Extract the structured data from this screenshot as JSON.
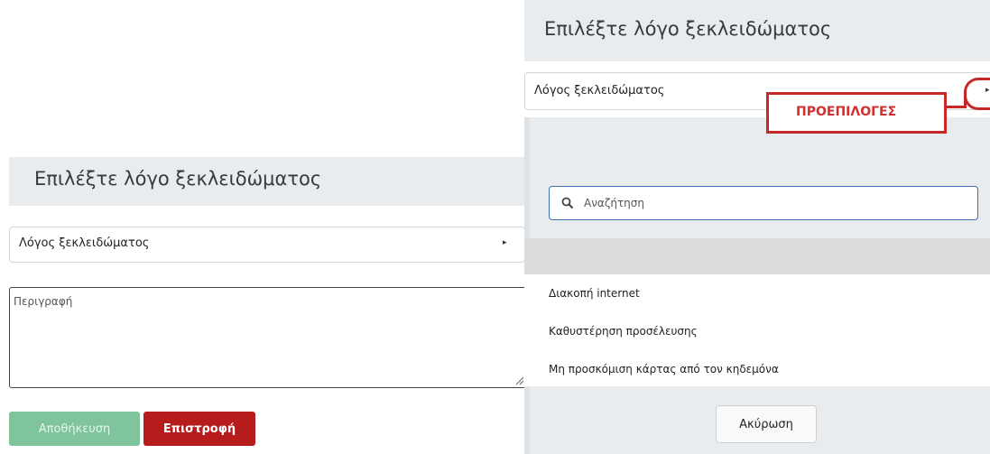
{
  "left_dialog": {
    "title": "Επιλέξτε λόγο ξεκλειδώματος",
    "reason_select": {
      "label": "Λόγος ξεκλειδώματος",
      "caret": "▸"
    },
    "description": {
      "placeholder": "Περιγραφή"
    },
    "save_label": "Αποθήκευση",
    "back_label": "Επιστροφή"
  },
  "right_dialog": {
    "title": "Επιλέξτε λόγο ξεκλειδώματος",
    "reason_select": {
      "label": "Λόγος ξεκλειδώματος",
      "caret": "▸"
    },
    "presets_callout": "ΠΡΟΕΠΙΛΟΓΕΣ",
    "search": {
      "placeholder": "Αναζήτηση"
    },
    "options": [
      "Διακοπή internet",
      "Καθυστέρηση προσέλευσης",
      "Μη προσκόμιση κάρτας από τον κηδεμόνα"
    ],
    "cancel_label": "Ακύρωση"
  },
  "colors": {
    "header_bg": "#e9ecef",
    "save_button": "#7fc49b",
    "back_button": "#b71c1c",
    "annotation_red": "#c62828",
    "search_focus_border": "#3b6fb6"
  },
  "icons": [
    "caret-right-icon",
    "search-icon",
    "resize-handle-icon"
  ]
}
